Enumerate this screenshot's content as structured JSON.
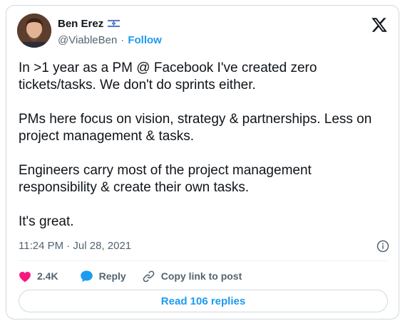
{
  "author": {
    "display_name": "Ben Erez",
    "handle": "@ViableBen",
    "separator": "·",
    "follow_label": "Follow",
    "flag_icon": "israel-flag-icon"
  },
  "tweet": {
    "paragraphs": [
      "In >1 year as a PM @ Facebook I've created zero tickets/tasks. We don't do sprints either.",
      "PMs here focus on vision, strategy & partnerships. Less on project management & tasks.",
      "Engineers carry most of the project management responsibility & create their own tasks.",
      "It's great."
    ],
    "timestamp": "11:24 PM · Jul 28, 2021"
  },
  "actions": {
    "like_count": "2.4K",
    "reply_label": "Reply",
    "copy_link_label": "Copy link to post"
  },
  "replies_button": {
    "label": "Read 106 replies"
  },
  "colors": {
    "accent": "#1d9bf0",
    "like": "#f91880",
    "text": "#0f1419",
    "muted": "#536471",
    "border": "#cfd9de"
  },
  "icons": {
    "platform": "x-logo-icon",
    "info": "info-icon",
    "like": "heart-icon",
    "reply": "speech-bubble-icon",
    "copy_link": "link-icon"
  }
}
